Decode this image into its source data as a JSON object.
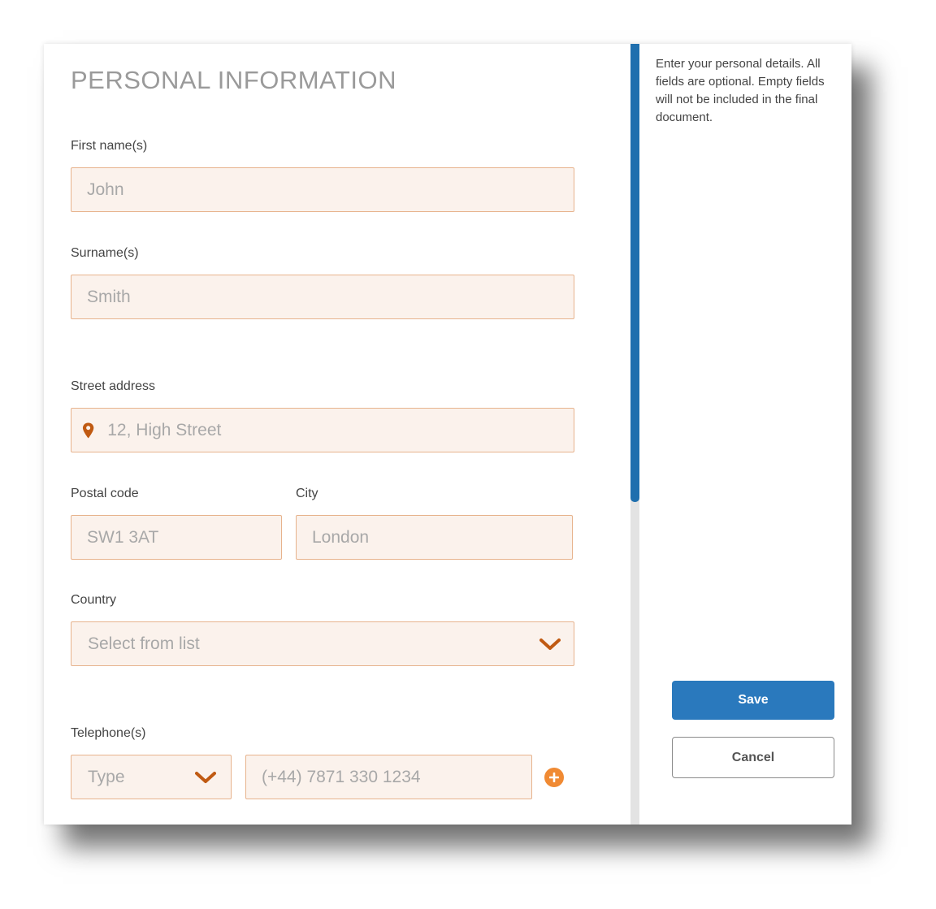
{
  "form": {
    "title": "PERSONAL INFORMATION",
    "first_name": {
      "label": "First name(s)",
      "placeholder": "John"
    },
    "surname": {
      "label": "Surname(s)",
      "placeholder": "Smith"
    },
    "street": {
      "label": "Street address",
      "placeholder": "12, High Street",
      "icon": "map-pin-icon"
    },
    "postal_code": {
      "label": "Postal code",
      "placeholder": "SW1 3AT"
    },
    "city": {
      "label": "City",
      "placeholder": "London"
    },
    "country": {
      "label": "Country",
      "selected": "Select from list",
      "icon": "chevron-down-icon"
    },
    "telephone": {
      "label": "Telephone(s)",
      "type_selected": "Type",
      "number_placeholder": "(+44) 7871 330 1234",
      "add_icon": "plus-circle-icon"
    }
  },
  "sidebar": {
    "help": "Enter your personal details. All fields are optional. Empty fields will not be included in the final document.",
    "save_label": "Save",
    "cancel_label": "Cancel"
  },
  "colors": {
    "accent_orange": "#c05a12",
    "field_bg": "#fbf2ec",
    "field_border": "#e7b38d",
    "primary_blue": "#2a79bd",
    "scrollbar_blue": "#1f6fae"
  }
}
